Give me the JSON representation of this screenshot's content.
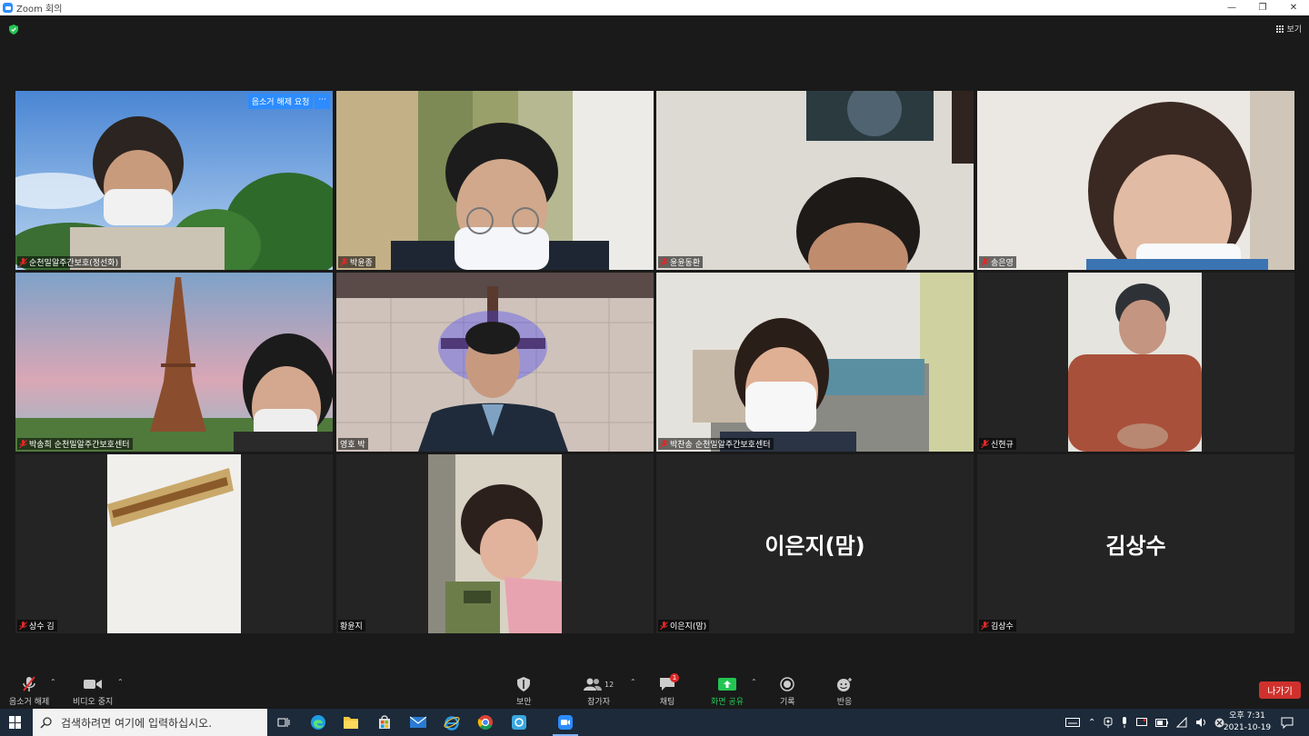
{
  "window": {
    "title": "Zoom 회의",
    "controls": [
      "minimize",
      "restore",
      "close"
    ]
  },
  "header": {
    "view_label": "보기"
  },
  "tiles": [
    {
      "name": "순천밀알주간보호(정선화)",
      "muted": true,
      "overlay_button": "음소거 해제 요청",
      "more": "···"
    },
    {
      "name": "박윤종",
      "muted": true
    },
    {
      "name": "윤윤동환",
      "muted": true
    },
    {
      "name": "송은영",
      "muted": true
    },
    {
      "name": "박송희 순천밀알주간보호센터",
      "muted": true
    },
    {
      "name": "영호 박",
      "muted": false,
      "active_speaker": true
    },
    {
      "name": "박찬송 순천밀알주간보호센터",
      "muted": true
    },
    {
      "name": "신현규",
      "muted": true
    },
    {
      "name": "상수 김",
      "muted": true
    },
    {
      "name": "황윤지",
      "muted": false
    },
    {
      "name": "이은지(맘)",
      "muted": true,
      "video_off": true,
      "display_name": "이은지(맘)"
    },
    {
      "name": "김상수",
      "muted": true,
      "video_off": true,
      "display_name": "김상수"
    }
  ],
  "toolbar": {
    "unmute": "음소거 해제",
    "stop_video": "비디오 중지",
    "security": "보안",
    "participants": "참가자",
    "participant_count": "12",
    "chat": "채팅",
    "chat_badge": "1",
    "share_screen": "화면 공유",
    "record": "기록",
    "reactions": "반응",
    "leave": "나가기"
  },
  "taskbar": {
    "search_placeholder": "검색하려면 여기에 입력하십시오.",
    "time": "오후 7:31",
    "date": "2021-10-19"
  },
  "colors": {
    "accent": "#2d8cff",
    "leave": "#d0312d",
    "active": "#e6e25a",
    "share": "#23c552"
  }
}
